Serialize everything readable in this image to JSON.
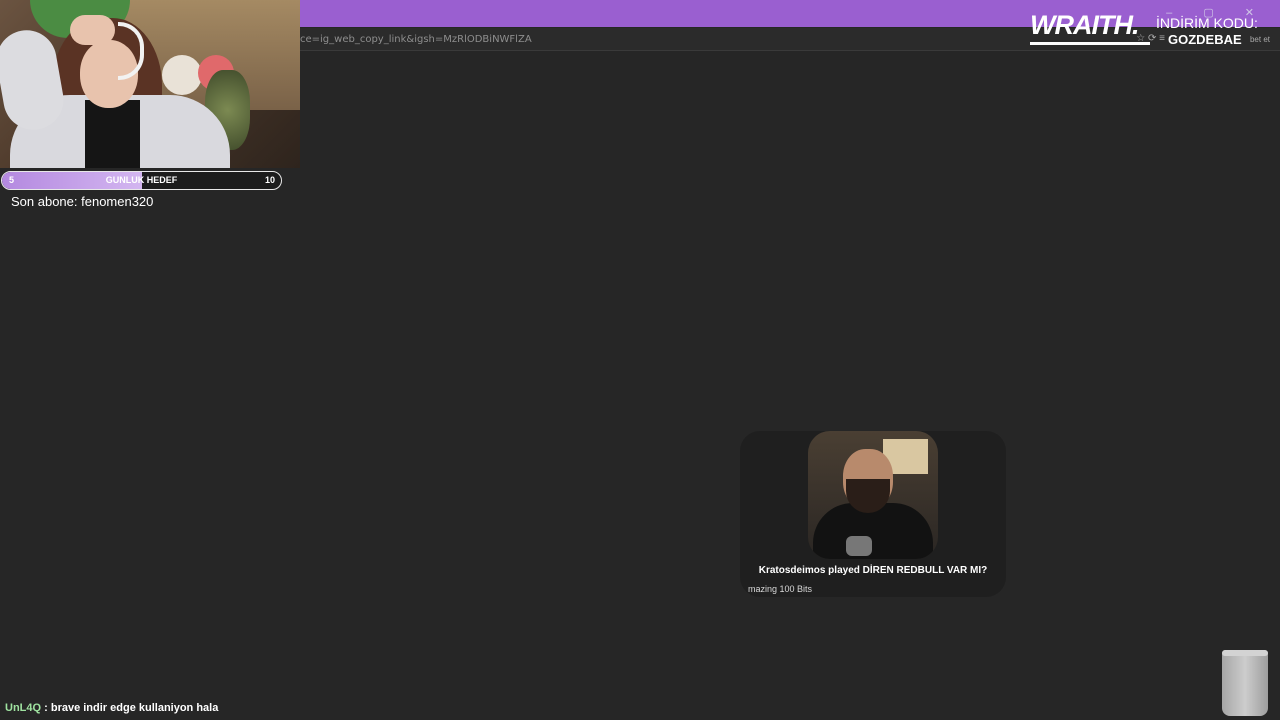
{
  "browser": {
    "url_fragment": "ce=ig_web_copy_link&igsh=MzRlODBiNWFlZA",
    "tail_text": "bet et",
    "window_controls": "–  ▢  ✕"
  },
  "overlay": {
    "goal": {
      "start": "5",
      "title": "GUNLUK HEDEF",
      "end": "10",
      "progress_fraction": 0.5
    },
    "last_subscriber": "Son abone: fenomen320",
    "sponsor": {
      "logo": "WRAITH.",
      "label": "İNDİRİM KODU:",
      "code": "GOZDEBAE"
    }
  },
  "alert": {
    "title": "Kratosdeimos played DİREN REDBULL VAR MI?",
    "subtitle": "mazing 100 Bits"
  },
  "chat": {
    "username": "UnL4Q",
    "message": ": brave indir edge kullaniyon hala"
  },
  "colors": {
    "accent_purple": "#9a5fd0",
    "goal_fill": "#c49fe9",
    "chat_username": "#9fe3a0",
    "background": "#262626"
  }
}
